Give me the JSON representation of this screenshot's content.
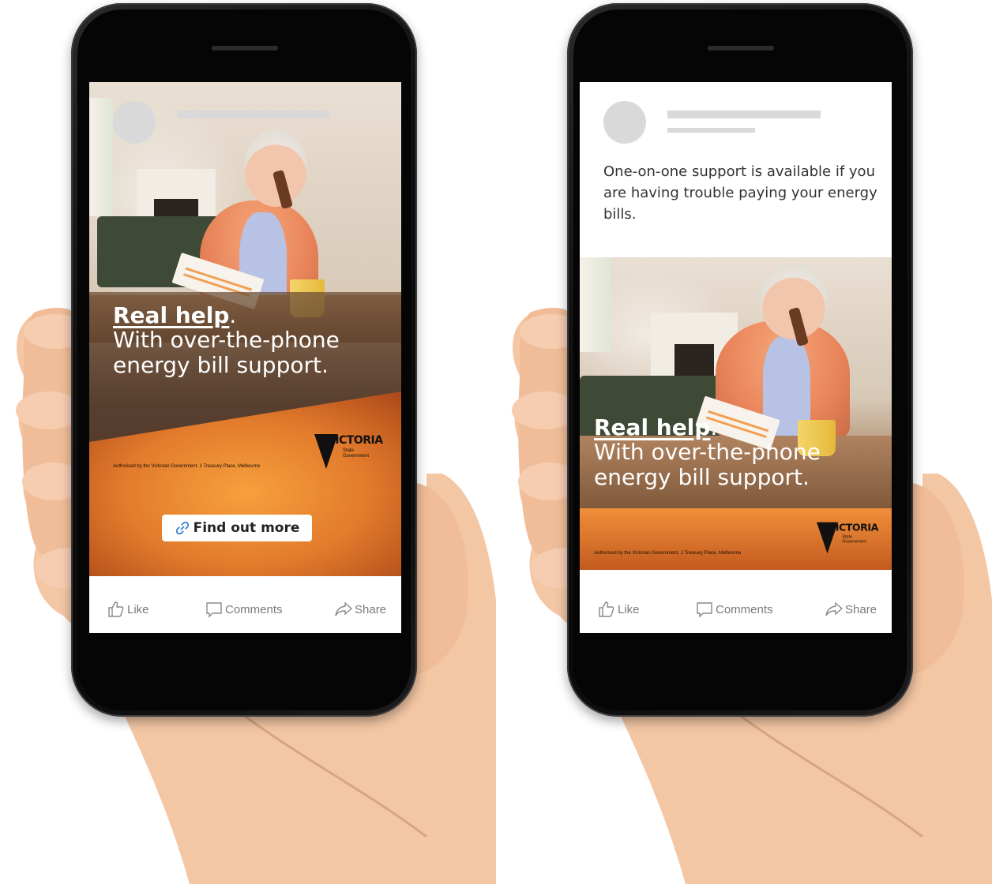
{
  "colors": {
    "orange": "#e8843a",
    "orange_dark": "#a04a14",
    "placeholder_gray": "#d9d9d9",
    "action_gray": "#7a7a7a"
  },
  "left_post": {
    "headline_bold": "Real help",
    "headline_period": ".",
    "headline_line1": "With over-the-phone",
    "headline_line2": "energy bill support.",
    "authorisation": "Authorised by the Victorian Government, 1 Treasury Place, Melbourne",
    "logo_word": "VICTORIA",
    "logo_sub1": "State",
    "logo_sub2": "Government",
    "cta_label": "Find out more",
    "cta_icon": "link-icon",
    "actions": [
      {
        "label": "Like",
        "icon": "thumbs-up-icon"
      },
      {
        "label": "Comments",
        "icon": "comment-icon"
      },
      {
        "label": "Share",
        "icon": "share-icon"
      }
    ]
  },
  "right_post": {
    "post_text": "One-on-one support is available if you are having trouble paying your energy bills.",
    "headline_bold": "Real help",
    "headline_period": ".",
    "headline_line1": "With over-the-phone",
    "headline_line2": "energy bill support.",
    "authorisation": "Authorised by the Victorian Government, 1 Treasury Place, Melbourne",
    "logo_word": "VICTORIA",
    "logo_sub1": "State",
    "logo_sub2": "Government",
    "actions": [
      {
        "label": "Like",
        "icon": "thumbs-up-icon"
      },
      {
        "label": "Comments",
        "icon": "comment-icon"
      },
      {
        "label": "Share",
        "icon": "share-icon"
      }
    ]
  }
}
